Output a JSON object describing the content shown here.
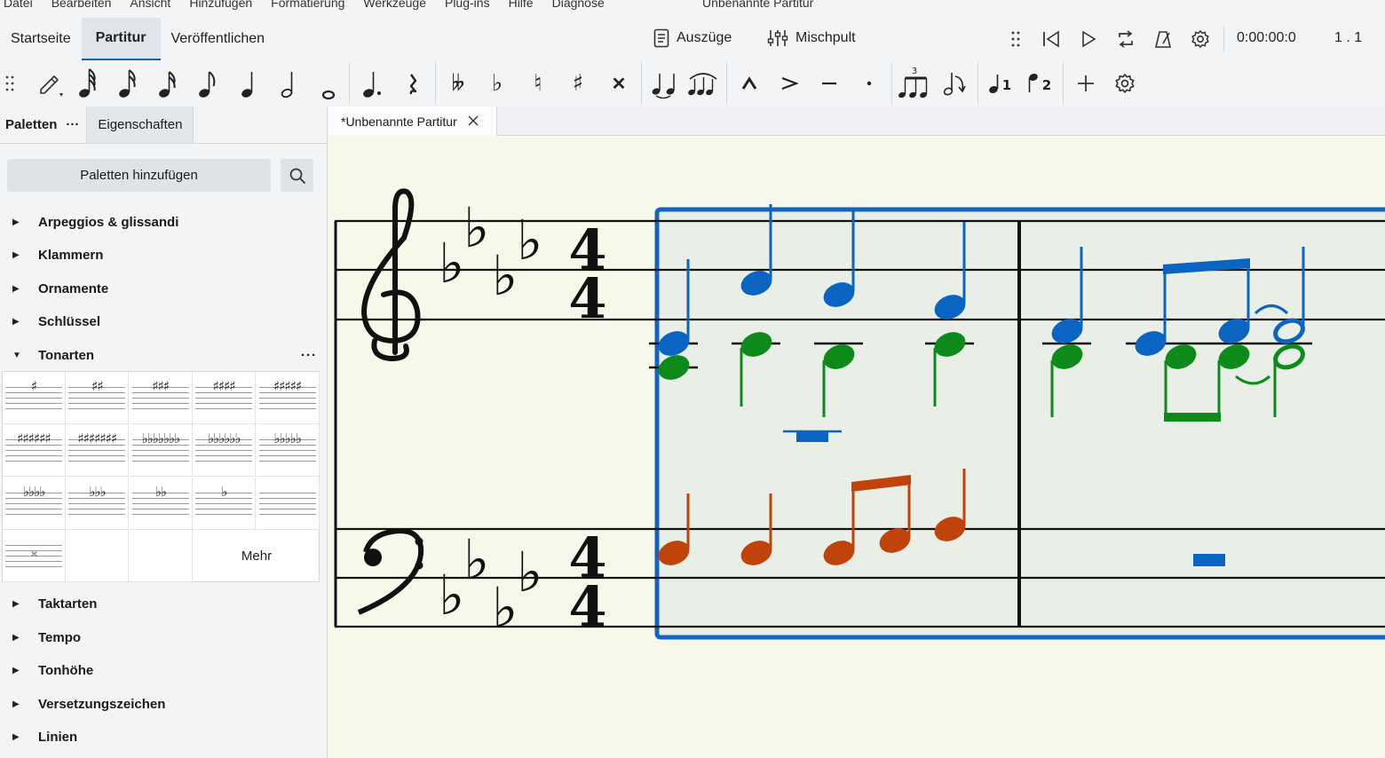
{
  "menu": {
    "items": [
      "Datei",
      "Bearbeiten",
      "Ansicht",
      "Hinzufügen",
      "Formatierung",
      "Werkzeuge",
      "Plug-ins",
      "Hilfe",
      "Diagnose"
    ],
    "window_title": "Unbenannte Partitur"
  },
  "tabs": {
    "home": "Startseite",
    "score": "Partitur",
    "publish": "Veröffentlichen"
  },
  "toolbar": {
    "parts_label": "Auszüge",
    "mixer_label": "Mischpult",
    "time_display": "0:00:00:0",
    "position_display": "1 . 1"
  },
  "panel": {
    "tab_palettes": "Paletten",
    "tab_palettes_more": "···",
    "tab_properties": "Eigenschaften",
    "add_palettes": "Paletten hinzufügen",
    "palettes_before": [
      "Arpeggios & glissandi",
      "Klammern",
      "Ornamente",
      "Schlüssel"
    ],
    "expanded_palette": "Tonarten",
    "expanded_more": "···",
    "palettes_after": [
      "Taktarten",
      "Tempo",
      "Tonhöhe",
      "Versetzungszeichen",
      "Linien"
    ],
    "key_more": "Mehr",
    "key_signatures": [
      "♯",
      "♯♯",
      "♯♯♯",
      "♯♯♯♯",
      "♯♯♯♯♯",
      "♯♯♯♯♯♯",
      "♯♯♯♯♯♯♯",
      "♭♭♭♭♭♭♭",
      "♭♭♭♭♭♭",
      "♭♭♭♭♭",
      "♭♭♭♭",
      "♭♭♭",
      "♭♭",
      "♭",
      "",
      "𝄪"
    ]
  },
  "document_tab": {
    "label": "*Unbenannte Partitur"
  },
  "colors": {
    "selection": "#1565c0",
    "voice1": "#0a64c2",
    "voice2": "#0d8a1a",
    "voice_bass": "#c0440a",
    "canvas": "#f7f8ea"
  }
}
